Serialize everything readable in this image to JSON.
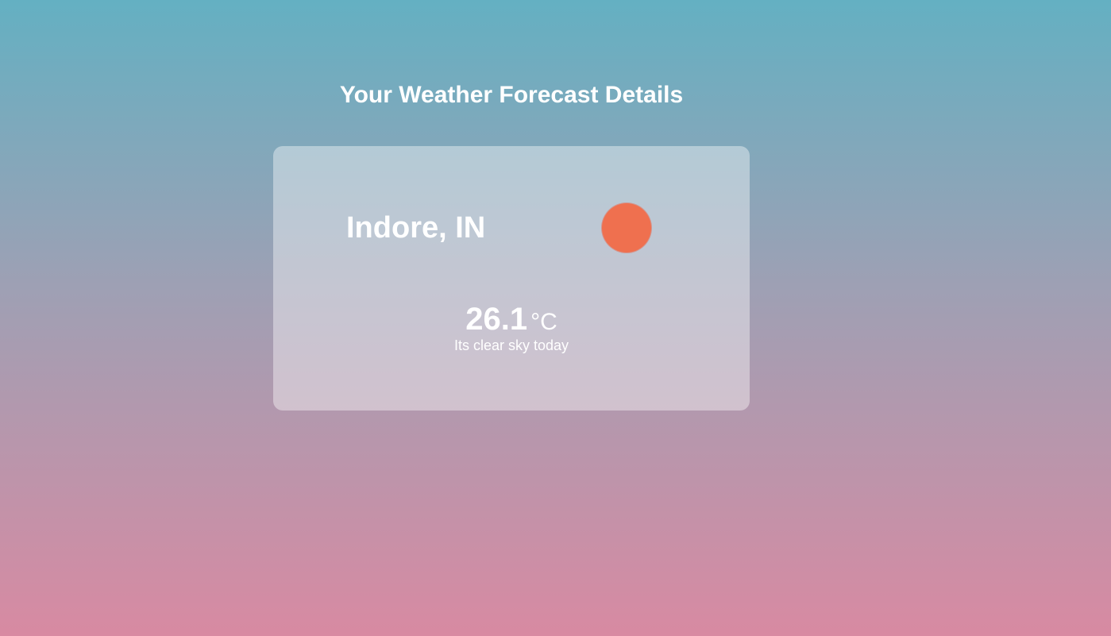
{
  "header": {
    "title": "Your Weather Forecast Details"
  },
  "weather": {
    "city": "Indore, IN",
    "temperature": "26.1",
    "unit": "°C",
    "description": "Its clear sky today",
    "icon": "sun-icon",
    "icon_color": "#ef704f"
  },
  "colors": {
    "background_top": "#64b0c2",
    "background_bottom": "#d88aa2"
  }
}
